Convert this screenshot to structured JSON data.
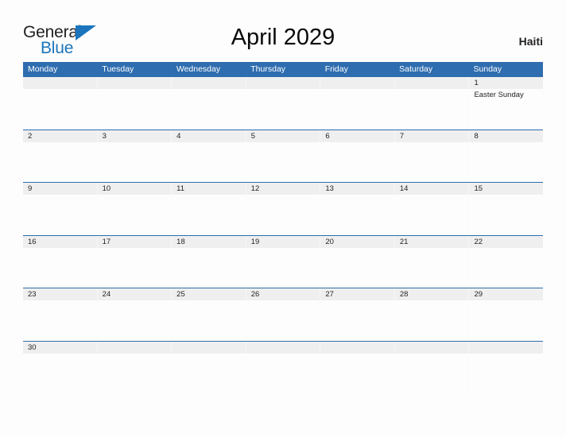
{
  "brand": {
    "name_part1": "General",
    "name_part2": "Blue",
    "flag_icon": "flag-triangle-icon",
    "color_dark": "#231f20",
    "color_blue": "#1b75bc"
  },
  "header": {
    "title": "April 2029",
    "country": "Haiti"
  },
  "calendar": {
    "header_color": "#2e6daf",
    "date_band_color": "#efefef",
    "weekdays": [
      "Monday",
      "Tuesday",
      "Wednesday",
      "Thursday",
      "Friday",
      "Saturday",
      "Sunday"
    ],
    "weeks": [
      {
        "dates": [
          "",
          "",
          "",
          "",
          "",
          "",
          "1"
        ],
        "events": [
          [],
          [],
          [],
          [],
          [],
          [],
          [
            "Easter Sunday"
          ]
        ]
      },
      {
        "dates": [
          "2",
          "3",
          "4",
          "5",
          "6",
          "7",
          "8"
        ],
        "events": [
          [],
          [],
          [],
          [],
          [],
          [],
          []
        ]
      },
      {
        "dates": [
          "9",
          "10",
          "11",
          "12",
          "13",
          "14",
          "15"
        ],
        "events": [
          [],
          [],
          [],
          [],
          [],
          [],
          []
        ]
      },
      {
        "dates": [
          "16",
          "17",
          "18",
          "19",
          "20",
          "21",
          "22"
        ],
        "events": [
          [],
          [],
          [],
          [],
          [],
          [],
          []
        ]
      },
      {
        "dates": [
          "23",
          "24",
          "25",
          "26",
          "27",
          "28",
          "29"
        ],
        "events": [
          [],
          [],
          [],
          [],
          [],
          [],
          []
        ]
      },
      {
        "dates": [
          "30",
          "",
          "",
          "",
          "",
          "",
          ""
        ],
        "events": [
          [],
          [],
          [],
          [],
          [],
          [],
          []
        ]
      }
    ]
  }
}
